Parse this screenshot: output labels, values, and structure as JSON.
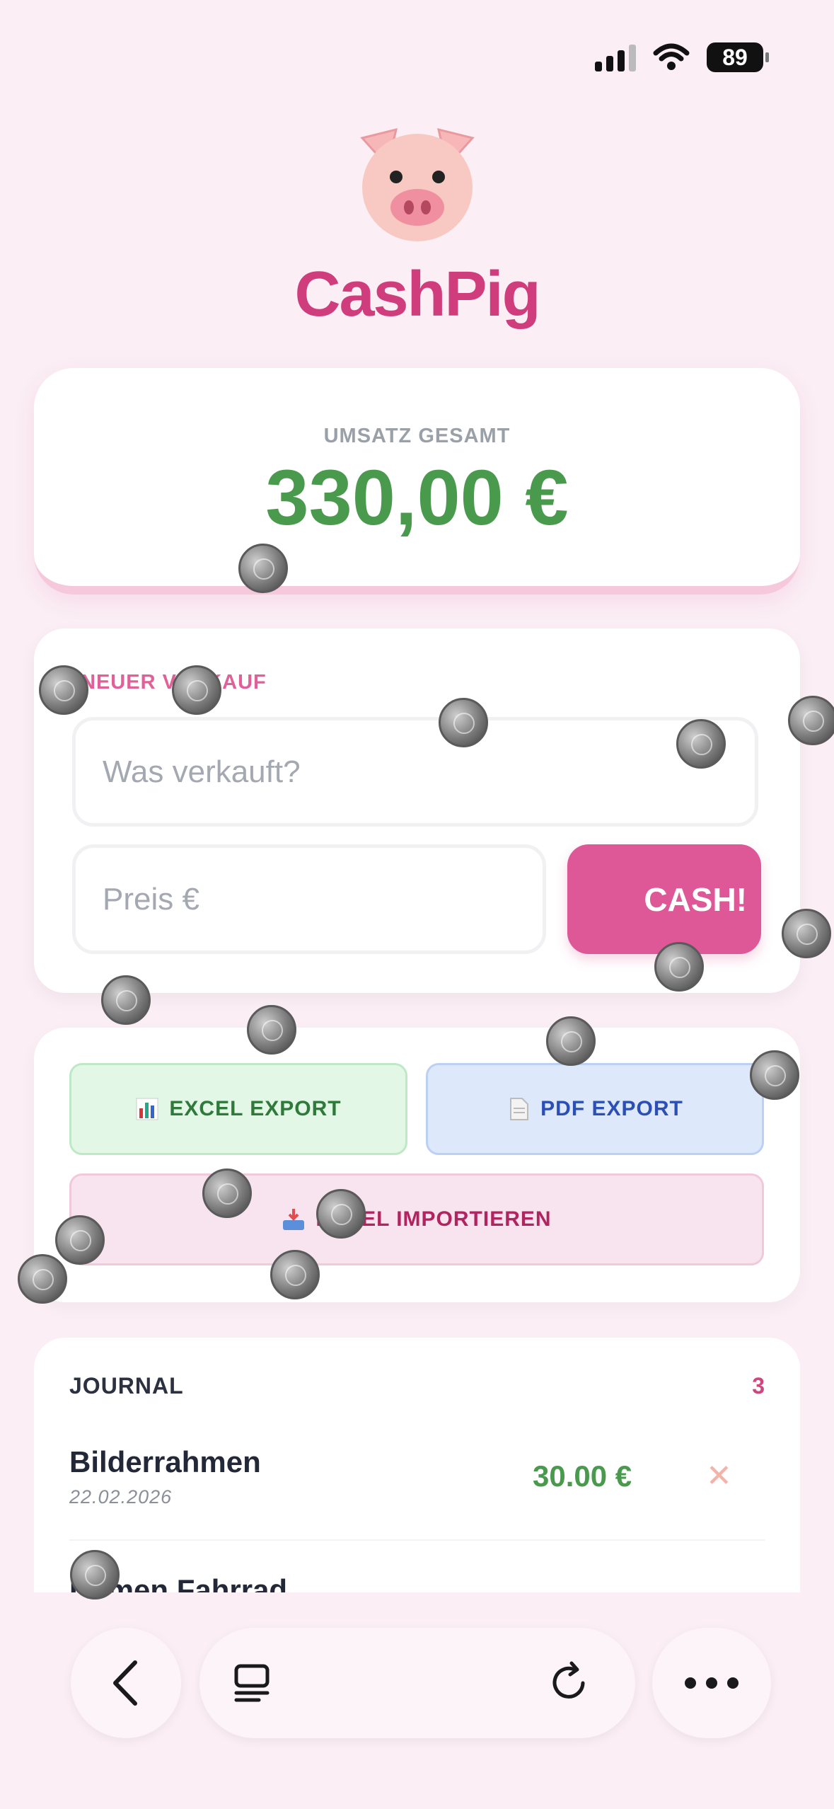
{
  "status_bar": {
    "battery": "89"
  },
  "app": {
    "title": "CashPig",
    "logo_icon": "pig-face-icon"
  },
  "total": {
    "label": "UMSATZ GESAMT",
    "value": "330,00 €"
  },
  "new_sale": {
    "label": "NEUER VERKAUF",
    "item_placeholder": "Was verkauft?",
    "price_placeholder": "Preis €",
    "submit_label": "CASH!"
  },
  "exports": {
    "excel_label": "EXCEL EXPORT",
    "pdf_label": "PDF EXPORT",
    "import_label": "EXCEL IMPORTIEREN"
  },
  "journal": {
    "title": "JOURNAL",
    "count": "3",
    "entries": [
      {
        "name": "Bilderrahmen",
        "date": "22.02.2026",
        "amount": "30.00 €",
        "delete": "✕"
      },
      {
        "name": "Damen Fahrrad"
      }
    ]
  },
  "colors": {
    "brand": "#cf3d7c",
    "accent_button": "#de5898",
    "money_green": "#4a9a4e",
    "background": "#fbeef5"
  }
}
